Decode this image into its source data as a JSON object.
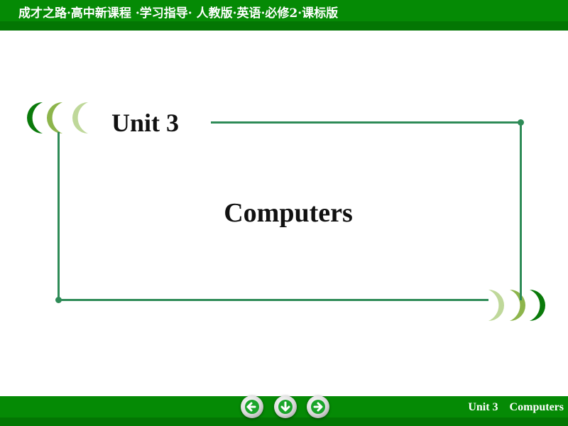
{
  "header": {
    "title": "成才之路·高中新课程 ·学习指导· 人教版·英语·必修2·课标版"
  },
  "slide": {
    "unit_label": "Unit 3",
    "title": "Computers"
  },
  "footer": {
    "nav_buttons": [
      {
        "icon": "arrow-left-icon",
        "label": "previous"
      },
      {
        "icon": "arrow-down-icon",
        "label": "down"
      },
      {
        "icon": "arrow-right-icon",
        "label": "next"
      }
    ],
    "caption": "Unit 3    Computers"
  },
  "colors": {
    "bar_green": "#058a05",
    "bar_dark_green": "#037603",
    "frame_line": "#2e8b57",
    "crescent_dark": "#0a7a0a",
    "crescent_mid": "#8db54c",
    "crescent_light": "#bfd89a",
    "arrow_green": "#1aa52a"
  }
}
